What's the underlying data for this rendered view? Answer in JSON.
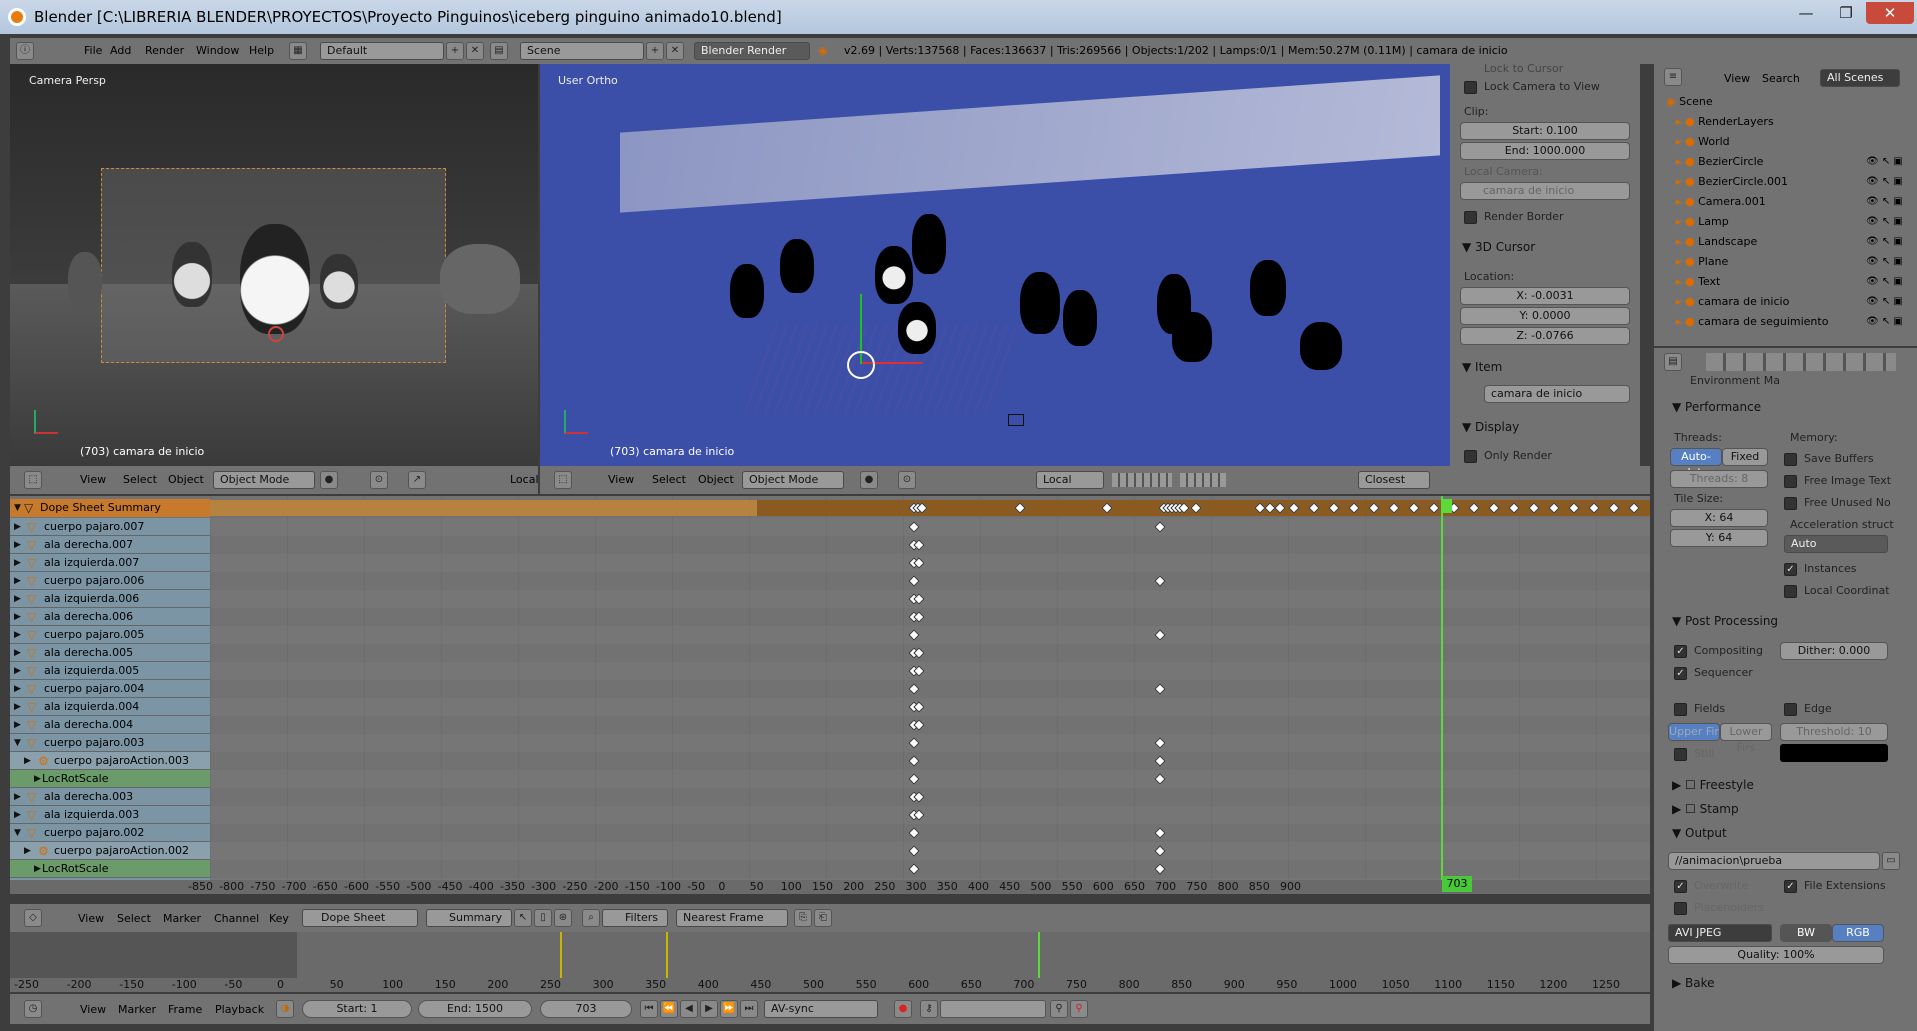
{
  "window": {
    "title": "Blender [C:\\LIBRERIA BLENDER\\PROYECTOS\\Proyecto Pinguinos\\iceberg pinguino animado10.blend]",
    "controls": [
      "—",
      "❐",
      "✕"
    ]
  },
  "info_header": {
    "menus": [
      "File",
      "Add",
      "Render",
      "Window",
      "Help"
    ],
    "screen_layout": "Default",
    "scene": "Scene",
    "engine": "Blender Render",
    "stats": "v2.69 | Verts:137568 | Faces:136637 | Tris:269566 | Objects:1/202 | Lamps:0/1 | Mem:50.27M (0.11M) | camara de inicio"
  },
  "camera_view": {
    "label": "Camera Persp",
    "footer": "(703) camara de inicio",
    "header": {
      "menus": [
        "View",
        "Select",
        "Object"
      ],
      "mode": "Object Mode",
      "orientation": "Local"
    }
  },
  "ortho_view": {
    "label": "User Ortho",
    "footer": "(703) camara de inicio",
    "header": {
      "menus": [
        "View",
        "Select",
        "Object"
      ],
      "mode": "Object Mode",
      "orientation": "Local",
      "snap": "Closest"
    }
  },
  "n_panel": {
    "lock_cursor": "Lock to Cursor",
    "lock_camera": "Lock Camera to View",
    "clip_label": "Clip:",
    "clip_start": "Start: 0.100",
    "clip_end": "End: 1000.000",
    "local_camera_label": "Local Camera:",
    "local_camera": "camara de inicio",
    "render_border": "Render Border",
    "cursor_section": "3D Cursor",
    "location_label": "Location:",
    "x": "X: -0.0031",
    "y": "Y: 0.0000",
    "z": "Z: -0.0766",
    "item_section": "Item",
    "item_name": "camara de inicio",
    "display_section": "Display",
    "only_render": "Only Render"
  },
  "outliner": {
    "menus": [
      "View",
      "Search"
    ],
    "scope": "All Scenes",
    "items": [
      "Scene",
      "RenderLayers",
      "World",
      "BezierCircle",
      "BezierCircle.001",
      "Camera.001",
      "Lamp",
      "Landscape",
      "Plane",
      "Text",
      "camara de inicio",
      "camara de seguimiento"
    ]
  },
  "properties": {
    "top_cut": "Environment Ma",
    "performance": "Performance",
    "threads": "Threads:",
    "autodetect": "Auto-dete",
    "fixed": "Fixed",
    "threads_count": "Threads: 8",
    "tile_size": "Tile Size:",
    "tile_x": "X: 64",
    "tile_y": "Y: 64",
    "memory": "Memory:",
    "save_buffers": "Save Buffers",
    "free_image": "Free Image Text",
    "free_unused": "Free Unused No",
    "accel": "Acceleration struct",
    "accel_val": "Auto",
    "instances": "Instances",
    "local_coords": "Local Coordinat",
    "post_processing": "Post Processing",
    "compositing": "Compositing",
    "dither": "Dither: 0.000",
    "sequencer": "Sequencer",
    "fields": "Fields",
    "edge": "Edge",
    "upper": "Upper Fir",
    "lower": "Lower Firs",
    "threshold": "Threshold: 10",
    "still": "Still",
    "freestyle": "Freestyle",
    "stamp": "Stamp",
    "output": "Output",
    "output_path": "//animacion\\prueba",
    "overwrite": "Overwrite",
    "file_ext": "File Extensions",
    "placeholders": "Placeholders",
    "format": "AVI JPEG",
    "bw": "BW",
    "rgb": "RGB",
    "quality": "Quality: 100%",
    "bake": "Bake"
  },
  "dopesheet": {
    "summary": "Dope Sheet Summary",
    "channels": [
      {
        "name": "cuerpo pajaro.007",
        "kind": "obj"
      },
      {
        "name": "ala derecha.007",
        "kind": "obj"
      },
      {
        "name": "ala izquierda.007",
        "kind": "obj"
      },
      {
        "name": "cuerpo pajaro.006",
        "kind": "obj"
      },
      {
        "name": "ala izquierda.006",
        "kind": "obj"
      },
      {
        "name": "ala derecha.006",
        "kind": "obj"
      },
      {
        "name": "cuerpo pajaro.005",
        "kind": "obj"
      },
      {
        "name": "ala derecha.005",
        "kind": "obj"
      },
      {
        "name": "ala izquierda.005",
        "kind": "obj"
      },
      {
        "name": "cuerpo pajaro.004",
        "kind": "obj"
      },
      {
        "name": "ala izquierda.004",
        "kind": "obj"
      },
      {
        "name": "ala derecha.004",
        "kind": "obj"
      },
      {
        "name": "cuerpo pajaro.003",
        "kind": "obj"
      },
      {
        "name": "cuerpo pajaroAction.003",
        "kind": "action"
      },
      {
        "name": "LocRotScale",
        "kind": "group"
      },
      {
        "name": "ala derecha.003",
        "kind": "obj"
      },
      {
        "name": "ala izquierda.003",
        "kind": "obj"
      },
      {
        "name": "cuerpo pajaro.002",
        "kind": "obj"
      },
      {
        "name": "cuerpo pajaroAction.002",
        "kind": "action"
      },
      {
        "name": "LocRotScale",
        "kind": "group"
      },
      {
        "name": "ala izquierda.002",
        "kind": "obj"
      }
    ],
    "ruler": [
      "-850",
      "-800",
      "-750",
      "-700",
      "-650",
      "-600",
      "-550",
      "-500",
      "-450",
      "-400",
      "-350",
      "-300",
      "-250",
      "-200",
      "-150",
      "-100",
      "-50",
      "0",
      "50",
      "100",
      "150",
      "200",
      "250",
      "300",
      "350",
      "400",
      "450",
      "500",
      "550",
      "600",
      "650",
      "700",
      "750",
      "800",
      "850",
      "900"
    ],
    "current_frame": "703",
    "header": {
      "menus": [
        "View",
        "Select",
        "Marker",
        "Channel",
        "Key"
      ],
      "mode": "Dope Sheet",
      "summary": "Summary",
      "filters": "Filters",
      "snap": "Nearest Frame"
    }
  },
  "timeline": {
    "ruler": [
      "-250",
      "-200",
      "-150",
      "-100",
      "-50",
      "0",
      "50",
      "100",
      "150",
      "200",
      "250",
      "300",
      "350",
      "400",
      "450",
      "500",
      "550",
      "600",
      "650",
      "700",
      "750",
      "800",
      "850",
      "900",
      "950",
      "1000",
      "1050",
      "1100",
      "1150",
      "1200",
      "1250"
    ],
    "header": {
      "menus": [
        "View",
        "Marker",
        "Frame",
        "Playback"
      ],
      "start": "Start: 1",
      "end": "End: 1500",
      "frame": "703",
      "sync": "AV-sync"
    }
  }
}
